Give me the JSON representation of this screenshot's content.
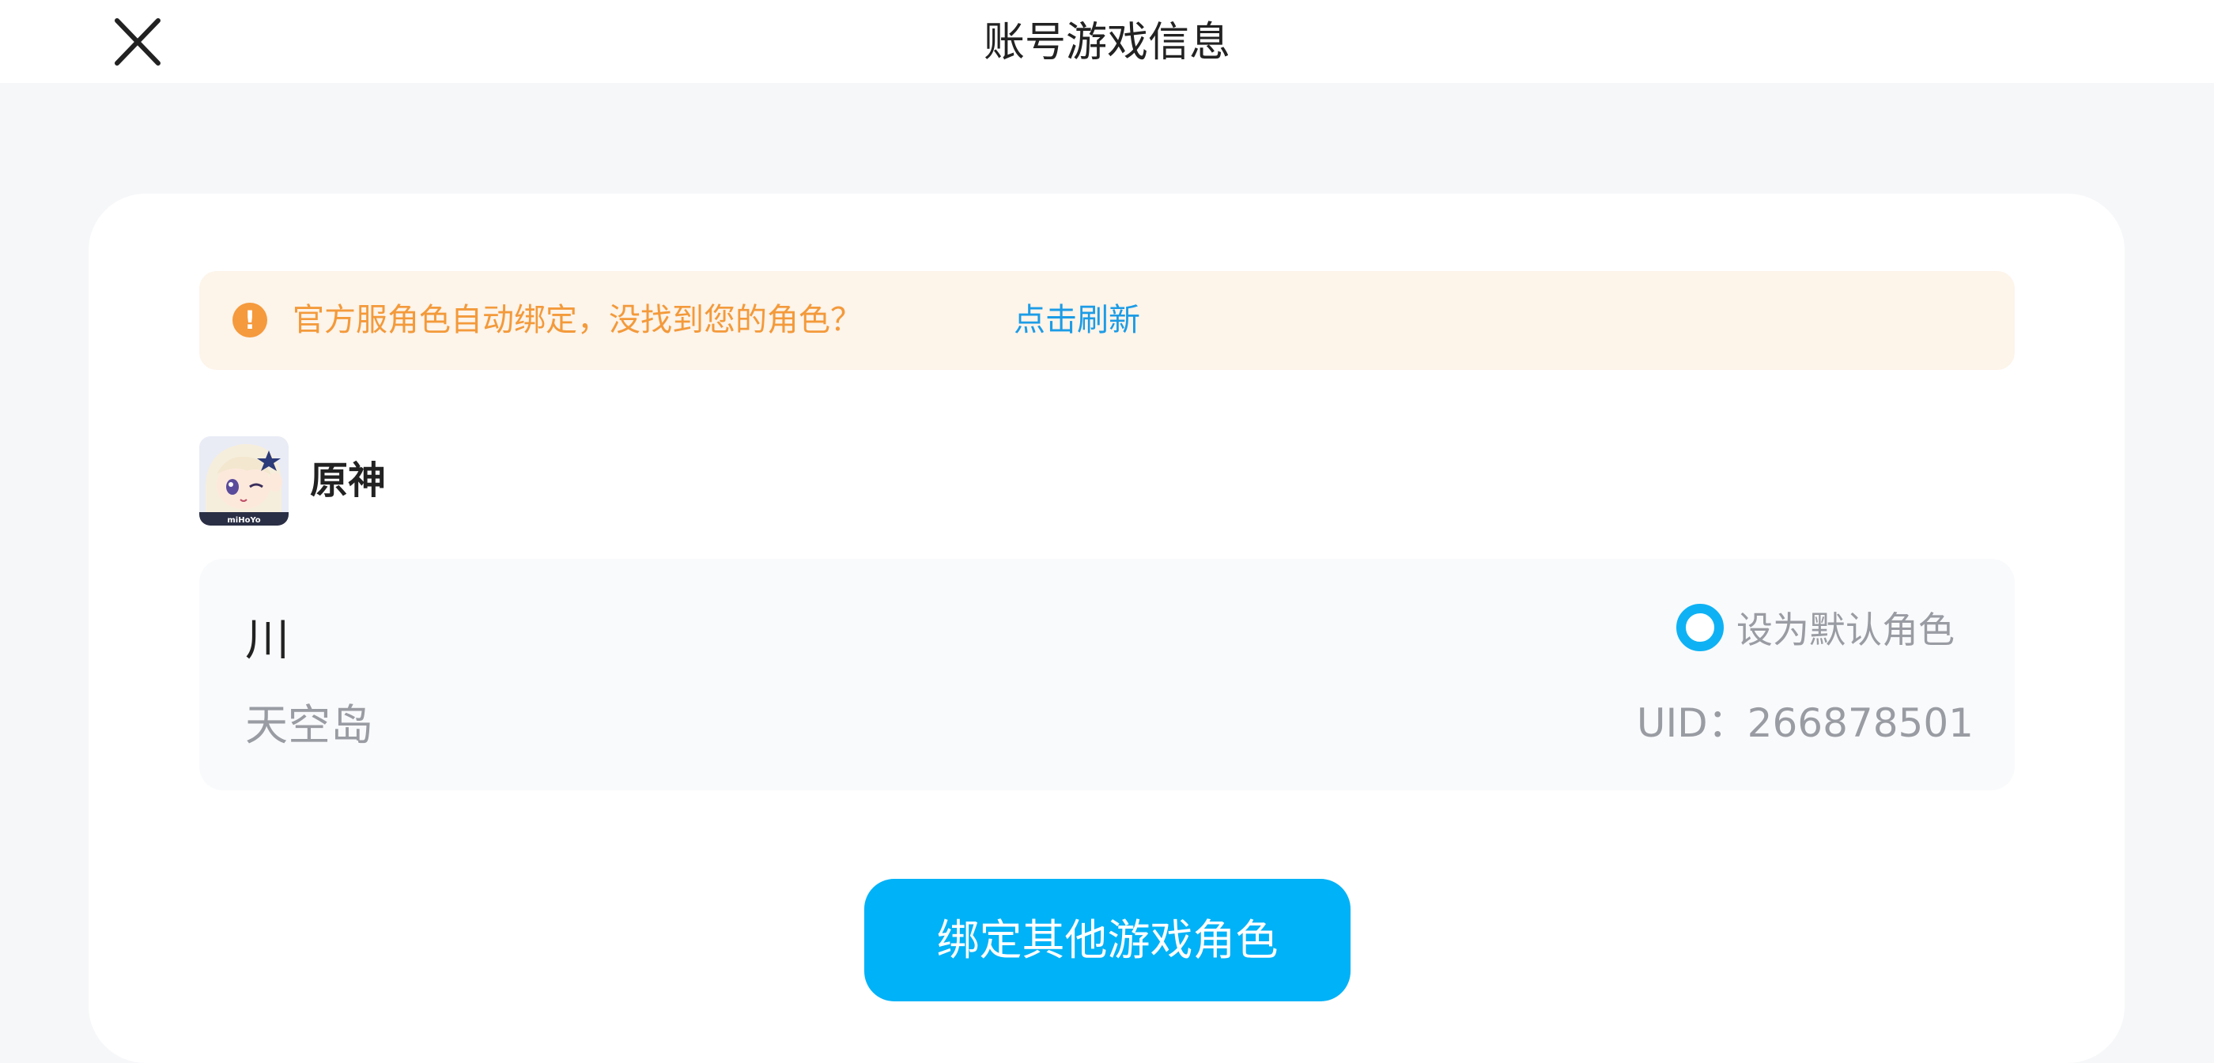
{
  "header": {
    "title": "账号游戏信息",
    "close_icon": "close-icon"
  },
  "notice": {
    "icon": "exclamation-icon",
    "text": "官方服角色自动绑定，没找到您的角色？",
    "link_label": "点击刷新",
    "text_color": "#f39a3b",
    "link_color": "#1c9ce6",
    "background_color": "#fdf4ea"
  },
  "game": {
    "name": "原神",
    "icon_badge_text": "miHoYo"
  },
  "role": {
    "name": "川",
    "server": "天空岛",
    "default_label": "设为默认角色",
    "default_selected": false,
    "uid_text": "UID：266878501"
  },
  "actions": {
    "bind_other_label": "绑定其他游戏角色",
    "accent_color": "#00b2f7"
  }
}
